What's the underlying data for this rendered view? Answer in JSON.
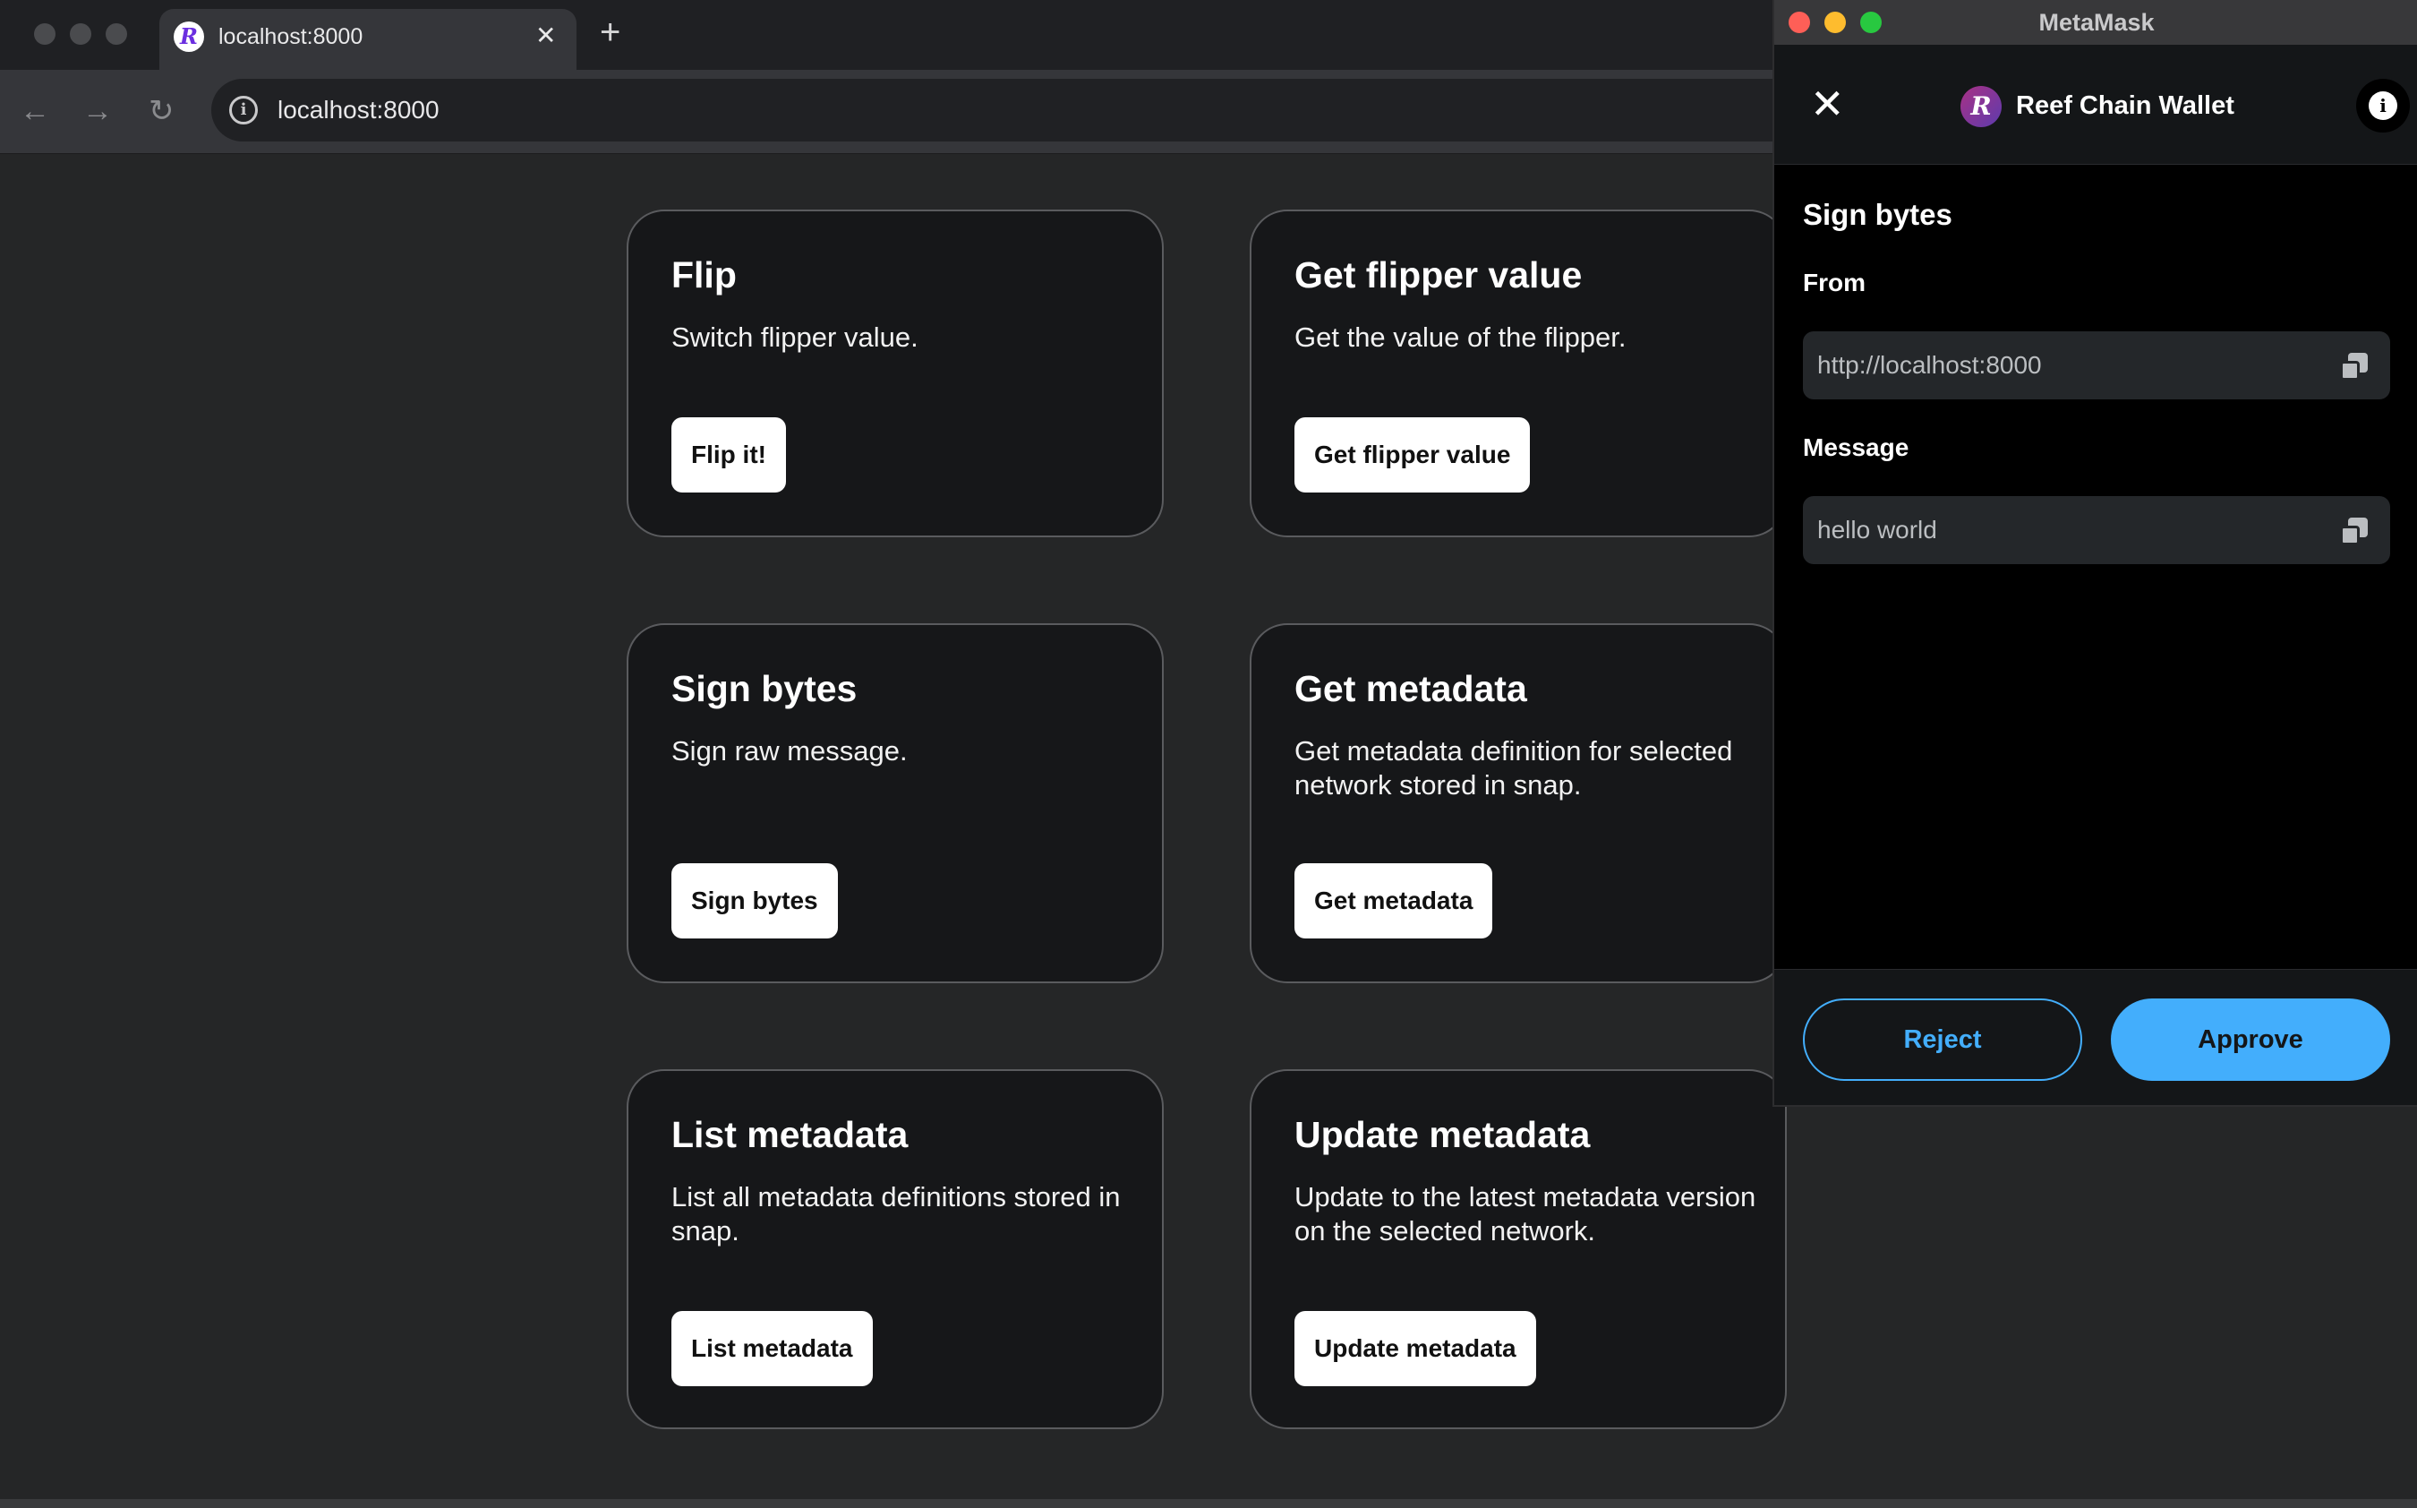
{
  "browser": {
    "tab_title": "localhost:8000",
    "tab_favicon": "R",
    "tab_close": "✕",
    "new_tab": "+",
    "url": "localhost:8000",
    "nav": {
      "back": "←",
      "forward": "→",
      "reload": "↻"
    },
    "info_glyph": "i"
  },
  "cards": [
    {
      "title": "Flip",
      "description": "Switch flipper value.",
      "button": "Flip it!"
    },
    {
      "title": "Get flipper value",
      "description": "Get the value of the flipper.",
      "button": "Get flipper value"
    },
    {
      "title": "Sign bytes",
      "description": "Sign raw message.",
      "button": "Sign bytes"
    },
    {
      "title": "Get metadata",
      "description": "Get metadata definition for selected network stored in snap.",
      "button": "Get metadata"
    },
    {
      "title": "List metadata",
      "description": "List all metadata definitions stored in snap.",
      "button": "List metadata"
    },
    {
      "title": "Update metadata",
      "description": "Update to the latest metadata version on the selected network.",
      "button": "Update metadata"
    }
  ],
  "metamask": {
    "window_title": "MetaMask",
    "close_glyph": "✕",
    "wallet_logo": "R",
    "wallet_name": "Reef Chain Wallet",
    "info_glyph": "i",
    "heading": "Sign bytes",
    "from_label": "From",
    "from_value": "http://localhost:8000",
    "message_label": "Message",
    "message_value": "hello world",
    "reject_label": "Reject",
    "approve_label": "Approve"
  },
  "colors": {
    "accent": "#43aefc",
    "page_bg": "#252627",
    "card_bg": "#161719",
    "popup_bg": "#000000"
  }
}
